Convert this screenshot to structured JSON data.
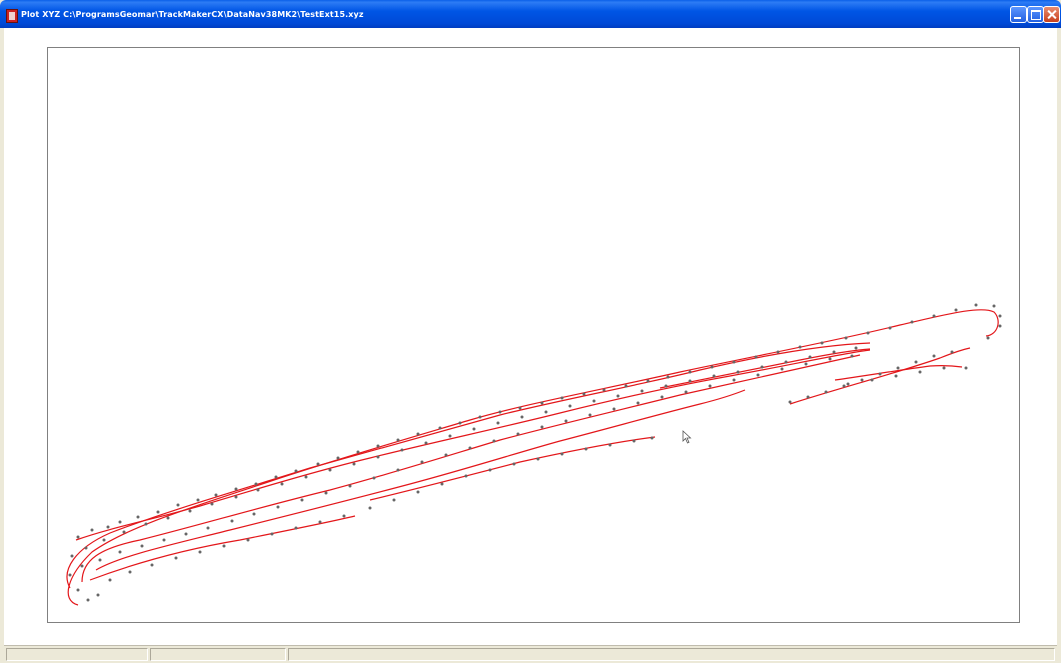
{
  "window": {
    "title": "Plot XYZ  C:\\ProgramsGeomar\\TrackMakerCX\\DataNav38MK2\\TestExt15.xyz",
    "icon": "app-icon",
    "buttons": [
      "minimize-icon",
      "maximize-icon",
      "close-icon"
    ]
  },
  "colors": {
    "track": "#e3161a",
    "points": "#666666",
    "frame": "#808080"
  },
  "statusbar": {
    "panel1": "",
    "panel2": "",
    "panel3": ""
  },
  "plot": {
    "track_count": 9
  }
}
